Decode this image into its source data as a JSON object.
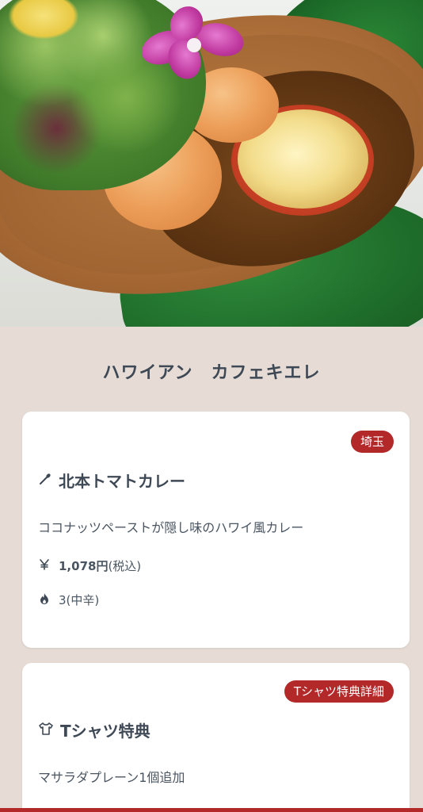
{
  "hero": {
    "image": "curry-plate-photo"
  },
  "shop_title": "ハワイアン　カフェキエレ",
  "menu_card": {
    "region_badge": "埼玉",
    "heading_icon": "spoon-icon",
    "dish_name": "北本トマトカレー",
    "description": "ココナッツペーストが隠し味のハワイ風カレー",
    "price_icon": "yen-icon",
    "price": "1,078円",
    "price_note": "(税込)",
    "spice_icon": "flame-icon",
    "spice_level": "3(中辛)"
  },
  "tshirt_card": {
    "detail_badge": "Tシャツ特典詳細",
    "heading_icon": "tshirt-icon",
    "heading": "Tシャツ特典",
    "benefit": "マサラダプレーン1個追加"
  },
  "colors": {
    "background": "#e6dcd5",
    "accent": "#b32828",
    "card": "#ffffff",
    "text": "#3e4955"
  }
}
